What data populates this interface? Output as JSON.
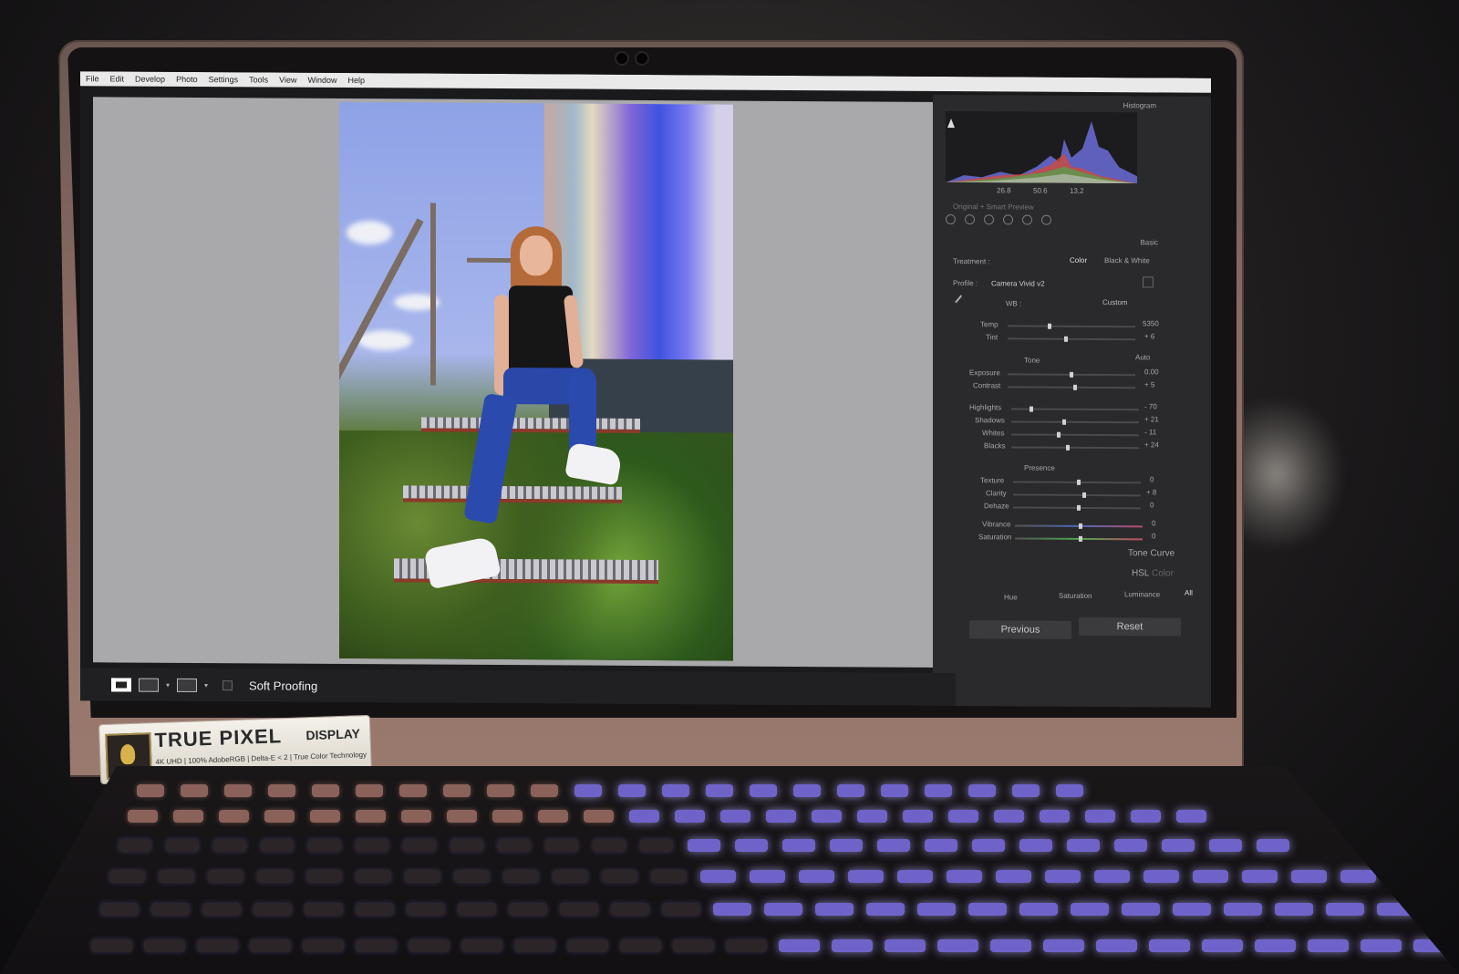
{
  "menu": [
    "File",
    "Edit",
    "Develop",
    "Photo",
    "Settings",
    "Tools",
    "View",
    "Window",
    "Help"
  ],
  "panel": {
    "histogram_title": "Histogram",
    "histogram_readout": [
      "26.8",
      "50.6",
      "13.2"
    ],
    "preview_label": "Original + Smart Preview",
    "basic_title": "Basic",
    "treatment_label": "Treatment :",
    "treatment_color": "Color",
    "treatment_bw": "Black & White",
    "profile_label": "Profile :",
    "profile_value": "Camera Vivid v2",
    "wb_label": "WB :",
    "wb_value": "Custom",
    "temp_label": "Temp",
    "temp_value": "5350",
    "tint_label": "Tint",
    "tint_value": "+ 6",
    "tone_label": "Tone",
    "auto_label": "Auto",
    "exposure_label": "Exposure",
    "exposure_value": "0.00",
    "contrast_label": "Contrast",
    "contrast_value": "+ 5",
    "highlights_label": "Highlights",
    "highlights_value": "- 70",
    "shadows_label": "Shadows",
    "shadows_value": "+ 21",
    "whites_label": "Whites",
    "whites_value": "- 11",
    "blacks_label": "Blacks",
    "blacks_value": "+ 24",
    "presence_label": "Presence",
    "texture_label": "Texture",
    "texture_value": "0",
    "clarity_label": "Clarity",
    "clarity_value": "+ 8",
    "dehaze_label": "Dehaze",
    "dehaze_value": "0",
    "vibrance_label": "Vibrance",
    "vibrance_value": "0",
    "saturation_label": "Saturation",
    "saturation_value": "0",
    "tone_curve_label": "Tone Curve",
    "hsl_label": "HSL",
    "hsl_color_label": "Color",
    "hsl_tabs": [
      "Hue",
      "Saturation",
      "Luminance",
      "All"
    ],
    "previous_label": "Previous",
    "reset_label": "Reset"
  },
  "bottombar": {
    "soft_proofing_label": "Soft Proofing"
  },
  "sticker": {
    "brand": "TRUE PIXEL",
    "product": "DISPLAY",
    "specs": "4K UHD | 100% AdobeRGB | Delta-E < 2 | True Color Technology"
  }
}
